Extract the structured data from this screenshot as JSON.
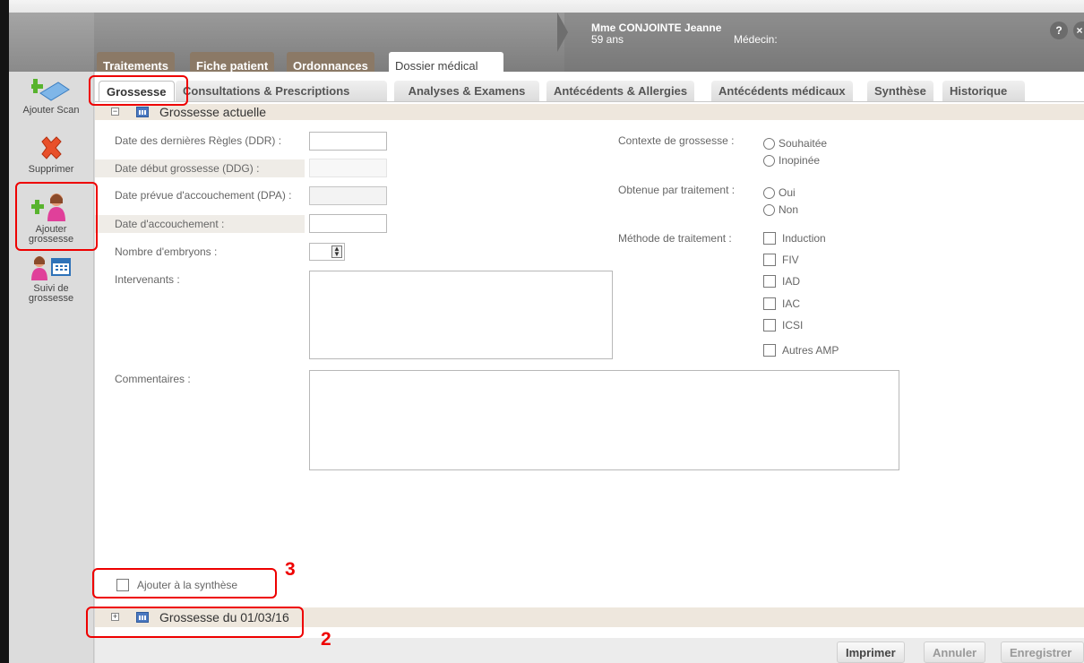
{
  "header": {
    "patient_name": "Mme CONJOINTE Jeanne",
    "patient_age": "59 ans",
    "doctor_label": "Médecin:",
    "help_label": "?",
    "close_label": "×"
  },
  "main_tabs": [
    "Traitements",
    "Fiche patient",
    "Ordonnances",
    "Dossier médical"
  ],
  "sub_tabs": [
    "Grossesse",
    "Consultations & Prescriptions",
    "Analyses & Examens",
    "Antécédents & Allergies",
    "Antécédents médicaux",
    "Synthèse",
    "Historique"
  ],
  "toolbar": {
    "add_scan": "Ajouter Scan",
    "delete": "Supprimer",
    "add_pregnancy": "Ajouter grossesse",
    "pregnancy_followup": "Suivi de grossesse"
  },
  "section": {
    "current_title": "Grossesse actuelle",
    "previous_title": "Grossesse du 01/03/16",
    "expand_minus": "−",
    "expand_plus": "+"
  },
  "form": {
    "ddr": "Date des dernières Règles (DDR) :",
    "ddg": "Date début grossesse (DDG) :",
    "dpa": "Date prévue d'accouchement (DPA) :",
    "delivery_date": "Date d'accouchement :",
    "embryos": "Nombre d'embryons :",
    "intervenants": "Intervenants :",
    "comments": "Commentaires :",
    "add_to_synthesis": "Ajouter à la synthèse",
    "context_label": "Contexte de grossesse :",
    "context_options": [
      "Souhaitée",
      "Inopinée"
    ],
    "treatment_label": "Obtenue par traitement :",
    "treatment_options": [
      "Oui",
      "Non"
    ],
    "method_label": "Méthode de traitement :",
    "method_options": [
      "Induction",
      "FIV",
      "IAD",
      "IAC",
      "ICSI",
      "Autres AMP"
    ]
  },
  "buttons": {
    "print": "Imprimer",
    "cancel": "Annuler",
    "save": "Enregistrer"
  },
  "annotations": [
    "3",
    "2"
  ],
  "colors": {
    "annotation": "#e00000",
    "tab_brown": "#8b7966",
    "section_bg": "#eee7dd"
  }
}
